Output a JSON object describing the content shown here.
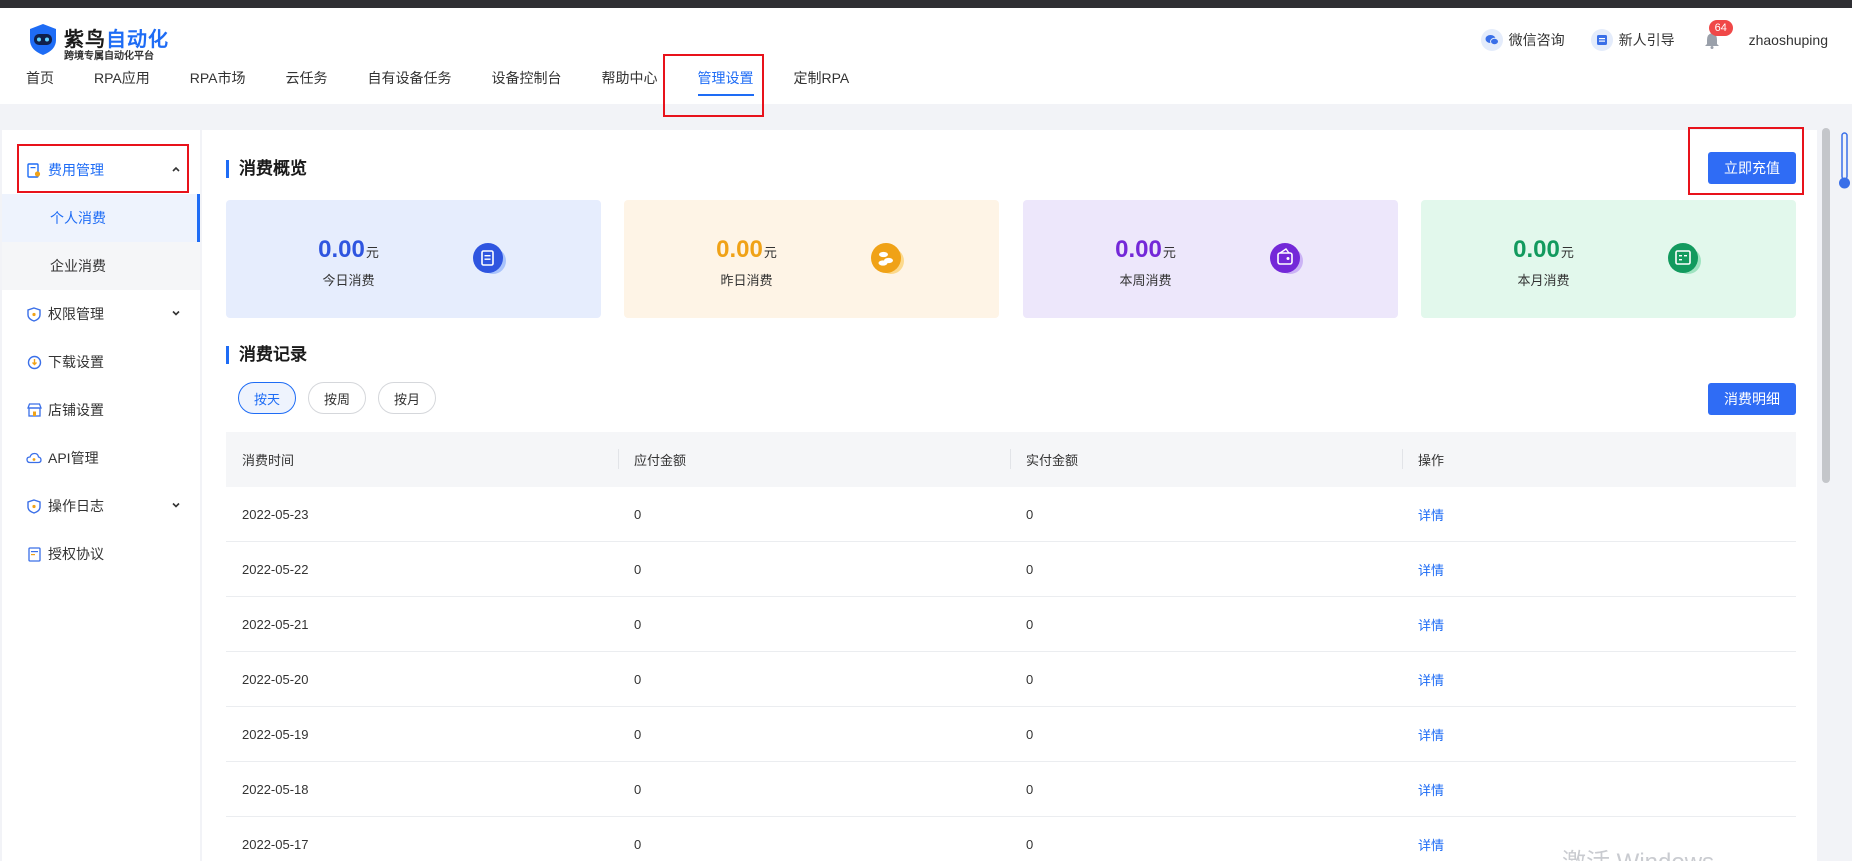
{
  "header": {
    "logo_title_main": "紫鸟",
    "logo_title_accent": "自动化",
    "logo_subtitle": "跨境专属自动化平台",
    "wechat_label": "微信咨询",
    "guide_label": "新人引导",
    "notification_count": "64",
    "username": "zhaoshuping"
  },
  "nav": [
    {
      "label": "首页"
    },
    {
      "label": "RPA应用"
    },
    {
      "label": "RPA市场"
    },
    {
      "label": "云任务"
    },
    {
      "label": "自有设备任务"
    },
    {
      "label": "设备控制台"
    },
    {
      "label": "帮助中心"
    },
    {
      "label": "管理设置",
      "active": true
    },
    {
      "label": "定制RPA"
    }
  ],
  "sidebar": {
    "fee_management": "费用管理",
    "personal_consumption": "个人消费",
    "enterprise_consumption": "企业消费",
    "permission_management": "权限管理",
    "download_settings": "下载设置",
    "shop_settings": "店铺设置",
    "api_management": "API管理",
    "operation_log": "操作日志",
    "authorization_agreement": "授权协议"
  },
  "overview": {
    "title": "消费概览",
    "recharge_button": "立即充值",
    "unit": "元",
    "cards": [
      {
        "value": "0.00",
        "label": "今日消费",
        "color": "#2f55e0",
        "bg": "#e6edfd",
        "icon": "document-icon"
      },
      {
        "value": "0.00",
        "label": "昨日消费",
        "color": "#f0a217",
        "bg": "#fef4e6",
        "icon": "coins-icon"
      },
      {
        "value": "0.00",
        "label": "本周消费",
        "color": "#7428d8",
        "bg": "#ede7fb",
        "icon": "wallet-icon"
      },
      {
        "value": "0.00",
        "label": "本月消费",
        "color": "#129a5e",
        "bg": "#e2f8ec",
        "icon": "calendar-money-icon"
      }
    ]
  },
  "records": {
    "title": "消费记录",
    "detail_button": "消费明细",
    "tabs": [
      {
        "label": "按天",
        "active": true
      },
      {
        "label": "按周"
      },
      {
        "label": "按月"
      }
    ],
    "columns": [
      "消费时间",
      "应付金额",
      "实付金额",
      "操作"
    ],
    "rows": [
      {
        "date": "2022-05-23",
        "payable": "0",
        "paid": "0",
        "action": "详情"
      },
      {
        "date": "2022-05-22",
        "payable": "0",
        "paid": "0",
        "action": "详情"
      },
      {
        "date": "2022-05-21",
        "payable": "0",
        "paid": "0",
        "action": "详情"
      },
      {
        "date": "2022-05-20",
        "payable": "0",
        "paid": "0",
        "action": "详情"
      },
      {
        "date": "2022-05-19",
        "payable": "0",
        "paid": "0",
        "action": "详情"
      },
      {
        "date": "2022-05-18",
        "payable": "0",
        "paid": "0",
        "action": "详情"
      },
      {
        "date": "2022-05-17",
        "payable": "0",
        "paid": "0",
        "action": "详情"
      }
    ]
  },
  "watermark": "激活 Windows"
}
